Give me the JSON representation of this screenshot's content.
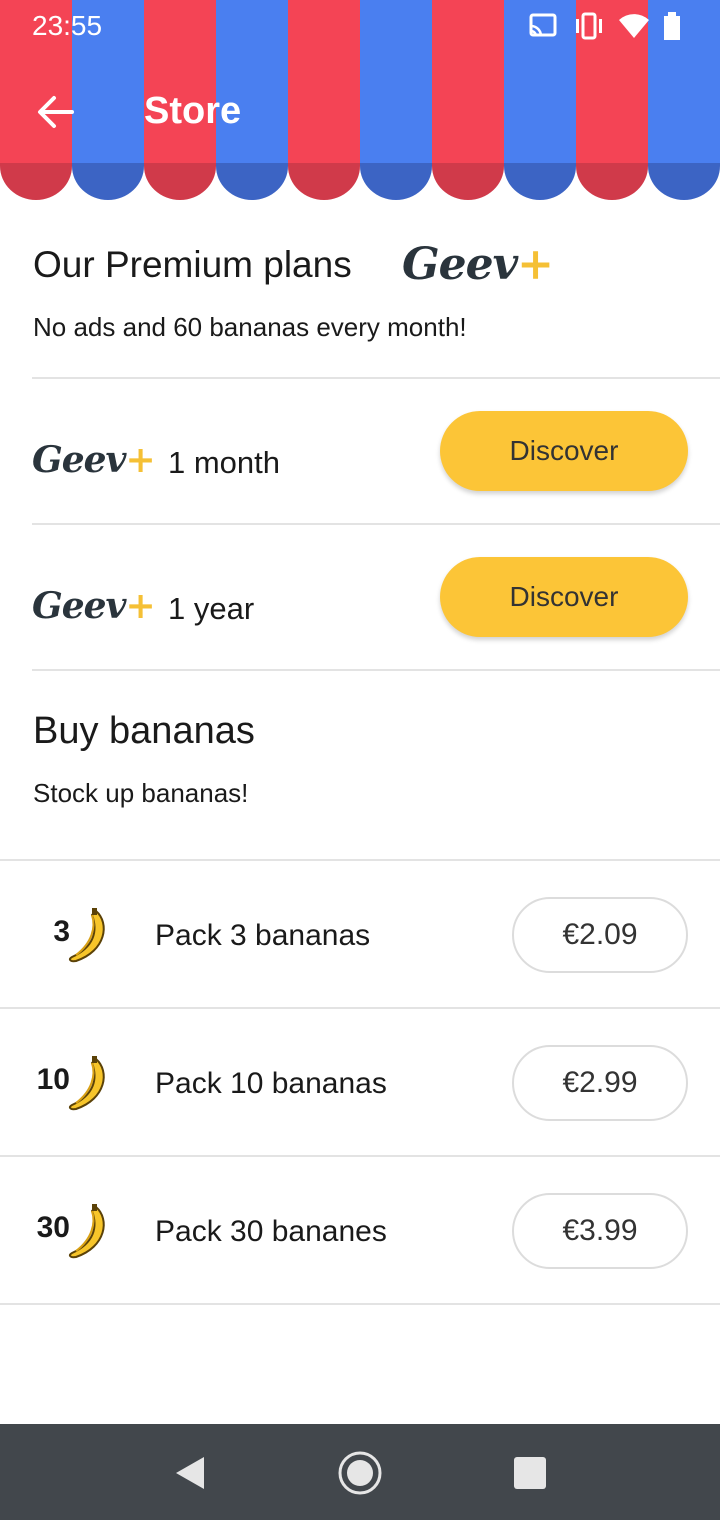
{
  "status_bar": {
    "time": "23:55"
  },
  "app_bar": {
    "title": "Store"
  },
  "premium": {
    "title": "Our Premium plans",
    "logo_text": "Geev",
    "logo_plus": "+",
    "subtitle": "No ads and 60 bananas every month!",
    "plans": [
      {
        "logo_text": "Geev",
        "logo_plus": "+",
        "label": "1 month",
        "button": "Discover"
      },
      {
        "logo_text": "Geev",
        "logo_plus": "+",
        "label": "1 year",
        "button": "Discover"
      }
    ]
  },
  "bananas": {
    "title": "Buy bananas",
    "subtitle": "Stock up bananas!",
    "packs": [
      {
        "count": "3",
        "label": "Pack 3 bananas",
        "price": "€2.09"
      },
      {
        "count": "10",
        "label": "Pack 10 bananas",
        "price": "€2.99"
      },
      {
        "count": "30",
        "label": "Pack 30 bananes",
        "price": "€3.99"
      }
    ]
  },
  "colors": {
    "awning_red": "#f44455",
    "awning_blue": "#4a7ff0",
    "accent_yellow": "#fcc537",
    "nav_bar": "#42474c"
  },
  "icons": {
    "status": [
      "cast-icon",
      "vibrate-icon",
      "wifi-icon",
      "battery-icon"
    ],
    "nav": [
      "back-triangle-icon",
      "home-circle-icon",
      "recents-square-icon"
    ]
  }
}
